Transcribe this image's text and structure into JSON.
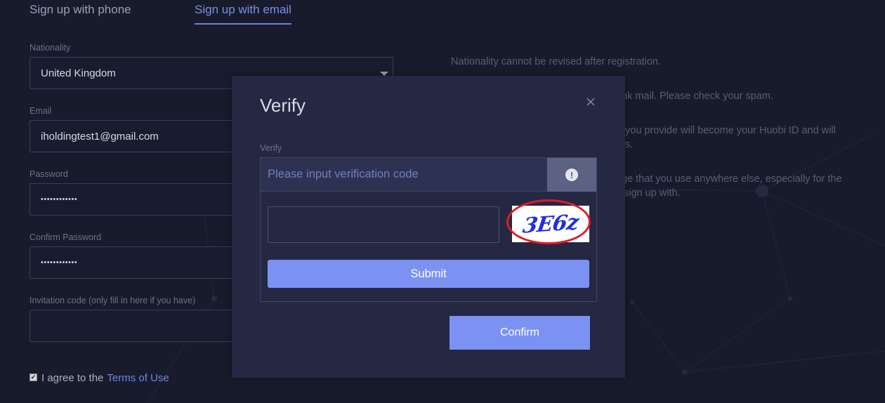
{
  "tabs": {
    "phone": "Sign up with phone",
    "email": "Sign up with email"
  },
  "form": {
    "nationality_label": "Nationality",
    "nationality_value": "United Kingdom",
    "email_label": "Email",
    "email_value": "iholdingtest1@gmail.com",
    "password_label": "Password",
    "password_value": "••••••••••••",
    "confirm_label": "Confirm Password",
    "confirm_value": "••••••••••••",
    "invite_label": "Invitation code (only fill in here if you have)",
    "invite_value": ""
  },
  "agree": {
    "text": "I agree to the",
    "link": "Terms of Use",
    "checked": true
  },
  "notes": {
    "n1": "Nationality cannot be revised after registration.",
    "n2": "nk mail. Please check your spam.",
    "n3a": "you provide will become your Huobi ID and will",
    "n3b": "s.",
    "n4a": "ge that you use anywhere else, especially for the",
    "n4b": "sign up with."
  },
  "modal": {
    "title": "Verify",
    "close_icon": "close-icon",
    "verify_label": "Verify",
    "verify_placeholder": "Please input verification code",
    "info_icon": "exclamation-icon",
    "captcha_text": "3E6z",
    "submit_label": "Submit",
    "confirm_label": "Confirm"
  },
  "colors": {
    "background": "#181b2c",
    "modal": "#252842",
    "accent": "#7c92f3",
    "tab_active": "#7b8ee8",
    "highlight_ring": "#e01b24"
  }
}
